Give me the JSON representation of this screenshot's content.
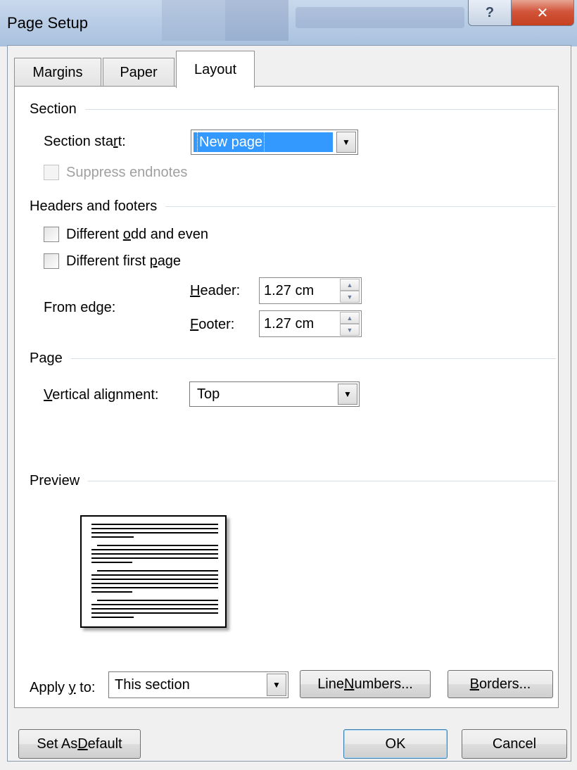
{
  "window": {
    "title": "Page Setup",
    "help_symbol": "?",
    "close_symbol": "✕"
  },
  "tabs": [
    {
      "label": "Margins"
    },
    {
      "label": "Paper"
    },
    {
      "label": "Layout",
      "selected": true
    }
  ],
  "section": {
    "heading": "Section",
    "start_label_pre": "Section sta",
    "start_label_key": "r",
    "start_label_post": "t:",
    "start_value": "New page",
    "suppress_label": "Suppress endnotes",
    "suppress_checked": false,
    "suppress_enabled": false
  },
  "headers_footers": {
    "heading": "Headers and footers",
    "odd_even_pre": "Different ",
    "odd_even_key": "o",
    "odd_even_post": "dd and even",
    "odd_even_checked": false,
    "first_page_pre": "Different first ",
    "first_page_key": "p",
    "first_page_post": "age",
    "first_page_checked": false,
    "from_edge_label": "From edge:",
    "header_key": "H",
    "header_rest": "eader:",
    "header_value": "1.27 cm",
    "footer_key": "F",
    "footer_rest": "ooter:",
    "footer_value": "1.27 cm"
  },
  "page": {
    "heading": "Page",
    "valign_key": "V",
    "valign_rest": "ertical alignment:",
    "valign_value": "Top"
  },
  "preview": {
    "heading": "Preview"
  },
  "apply": {
    "label_pre": "Apply ",
    "label_key": "y",
    "label_post": " to:",
    "value": "This section"
  },
  "buttons": {
    "line_numbers_pre": "Line ",
    "line_numbers_key": "N",
    "line_numbers_post": "umbers...",
    "borders_key": "B",
    "borders_post": "orders...",
    "set_default_pre": "Set As ",
    "set_default_key": "D",
    "set_default_post": "efault",
    "ok": "OK",
    "cancel": "Cancel"
  },
  "colors": {
    "selection": "#3399ff",
    "disabled_text": "#a0a0a0"
  }
}
